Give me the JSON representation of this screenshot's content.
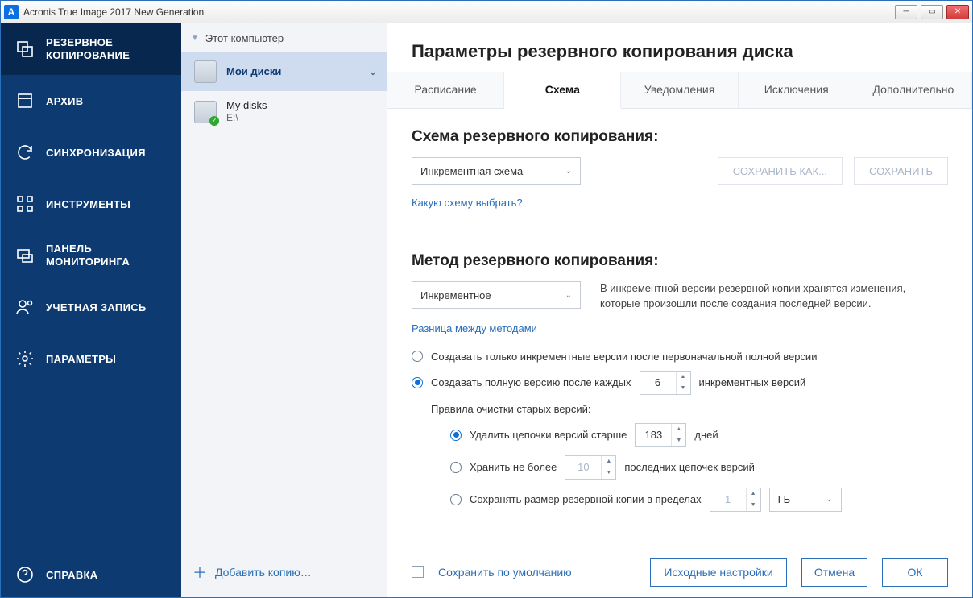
{
  "titlebar": {
    "app_letter": "A",
    "title": "Acronis True Image 2017 New Generation"
  },
  "sidebar": {
    "items": [
      {
        "label": "РЕЗЕРВНОЕ КОПИРОВАНИЕ"
      },
      {
        "label": "АРХИВ"
      },
      {
        "label": "СИНХРОНИЗАЦИЯ"
      },
      {
        "label": "ИНСТРУМЕНТЫ"
      },
      {
        "label": "ПАНЕЛЬ МОНИТОРИНГА"
      },
      {
        "label": "УЧЕТНАЯ ЗАПИСЬ"
      },
      {
        "label": "ПАРАМЕТРЫ"
      }
    ],
    "help": "СПРАВКА"
  },
  "secondCol": {
    "header": "Этот компьютер",
    "items": [
      {
        "title": "Мои диски",
        "sub": ""
      },
      {
        "title": "My disks",
        "sub": "E:\\"
      }
    ],
    "add": "Добавить копию…"
  },
  "main": {
    "header": "Параметры резервного копирования диска",
    "tabs": [
      "Расписание",
      "Схема",
      "Уведомления",
      "Исключения",
      "Дополнительно"
    ],
    "scheme": {
      "title": "Схема резервного копирования:",
      "select": "Инкрементная схема",
      "save_as": "СОХРАНИТЬ КАК...",
      "save": "СОХРАНИТЬ",
      "help": "Какую схему выбрать?"
    },
    "method": {
      "title": "Метод резервного копирования:",
      "select": "Инкрементное",
      "desc": "В инкрементной версии резервной копии хранятся изменения, которые произошли после создания последней версии.",
      "diff_link": "Разница между методами",
      "opt1": "Создавать только инкрементные версии после первоначальной полной версии",
      "opt2_a": "Создавать полную версию после каждых",
      "opt2_val": "6",
      "opt2_b": "инкрементных версий",
      "rules_title": "Правила очистки старых версий:",
      "rule1_a": "Удалить цепочки версий старше",
      "rule1_val": "183",
      "rule1_b": "дней",
      "rule2_a": "Хранить не более",
      "rule2_val": "10",
      "rule2_b": "последних цепочек версий",
      "rule3_a": "Сохранять размер резервной копии в пределах",
      "rule3_val": "1",
      "rule3_unit": "ГБ"
    }
  },
  "footer": {
    "save_default": "Сохранить по умолчанию",
    "defaults": "Исходные настройки",
    "cancel": "Отмена",
    "ok": "ОК"
  }
}
